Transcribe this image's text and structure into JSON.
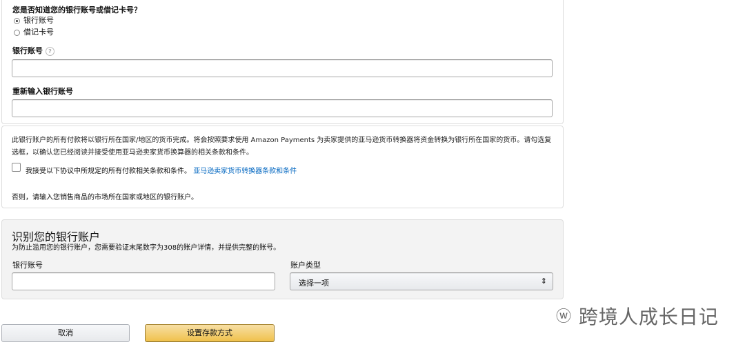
{
  "know_section": {
    "question": "您是否知道您的银行账号或借记卡号？",
    "options": [
      "银行账号",
      "借记卡号"
    ],
    "selected_index": 0,
    "bank_account_label": "银行账号",
    "reenter_label": "重新输入银行账号",
    "help_icon": "?"
  },
  "terms_section": {
    "text": "此银行账户的所有付款将以银行所在国家/地区的货币完成。将会按照要求使用 Amazon Payments 为卖家提供的亚马逊货币转换器将资金转换为银行所在国家的货币。请勾选复选框，以确认您已经阅读并接受使用亚马逊卖家货币换算器的相关条款和条件。",
    "checkbox_label": "我接受以下协议中所规定的所有付款相关条款和条件。",
    "link_text": "亚马逊卖家货币转换器条款和条件",
    "checked": false,
    "otherwise_text": "否则，请输入您销售商品的市场所在国家或地区的银行账户。"
  },
  "identify_section": {
    "title": "识别您的银行账户",
    "subtitle": "为防止滥用您的银行账户，您需要验证末尾数字为308的账户详情，并提供完整的账号。",
    "bank_account_label": "银行账号",
    "account_type_label": "账户类型",
    "account_type_value": "选择一项",
    "select_arrow": "⇕"
  },
  "buttons": {
    "cancel": "取消",
    "submit": "设置存款方式"
  },
  "watermark": {
    "text": "跨境人成长日记",
    "icon_glyph": "ⓦ"
  }
}
